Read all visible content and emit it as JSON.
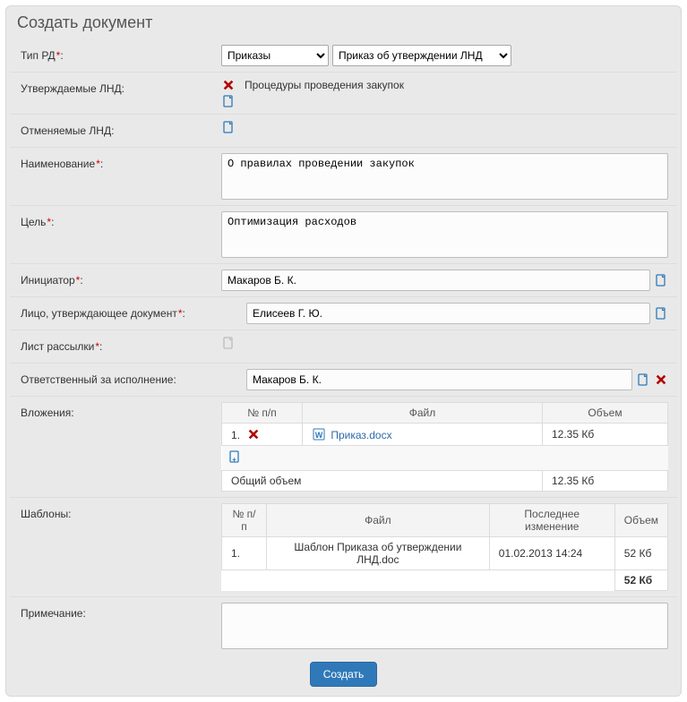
{
  "page": {
    "title": "Создать документ"
  },
  "labels": {
    "type_rd": "Тип РД",
    "approved_lnd": "Утверждаемые ЛНД:",
    "cancelled_lnd": "Отменяемые ЛНД:",
    "name": "Наименование",
    "purpose": "Цель",
    "initiator": "Инициатор",
    "approver": "Лицо, утверждающее документ",
    "mailing_list": "Лист рассылки",
    "responsible": "Ответственный за исполнение:",
    "attachments": "Вложения:",
    "templates": "Шаблоны:",
    "note": "Примечание:"
  },
  "type_rd": {
    "select1": "Приказы",
    "select2": "Приказ об утверждении ЛНД"
  },
  "approved_lnd": {
    "item": "Процедуры проведения закупок"
  },
  "fields": {
    "name": "О правилах проведении закупок",
    "purpose": "Оптимизация расходов",
    "initiator": "Макаров Б. К.",
    "approver": "Елисеев Г. Ю.",
    "responsible": "Макаров Б. К.",
    "note": ""
  },
  "attachments": {
    "headers": {
      "num": "№ п/п",
      "file": "Файл",
      "size": "Объем"
    },
    "rows": [
      {
        "num": "1.",
        "file": "Приказ.docx",
        "size": "12.35 Кб"
      }
    ],
    "total_label": "Общий объем",
    "total_size": "12.35 Кб"
  },
  "templates": {
    "headers": {
      "num": "№ п/п",
      "file": "Файл",
      "modified": "Последнее изменение",
      "size": "Объем"
    },
    "rows": [
      {
        "num": "1.",
        "file": "Шаблон Приказа об утверждении ЛНД.doc",
        "modified": "01.02.2013 14:24",
        "size": "52 Кб"
      }
    ],
    "total_size": "52 Кб"
  },
  "buttons": {
    "submit": "Создать"
  },
  "colors": {
    "accent": "#2f79b9",
    "danger": "#b20000"
  }
}
